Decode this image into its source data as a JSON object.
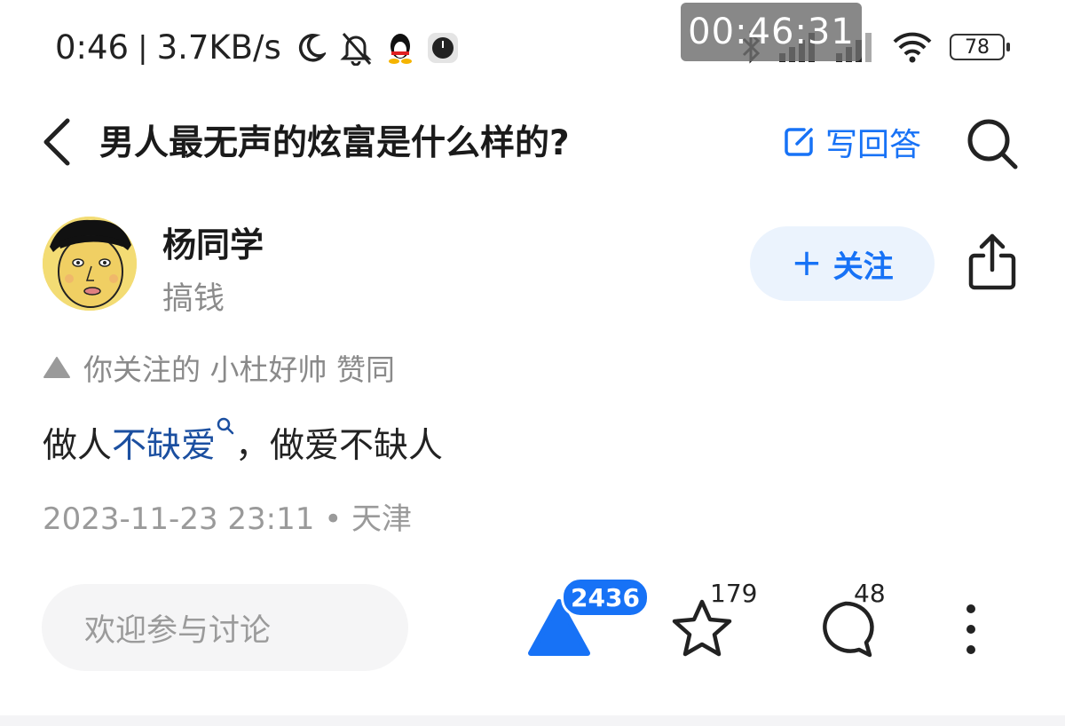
{
  "status_bar": {
    "time": "0:46",
    "net_speed": "3.7KB/s",
    "recording_timer": "00:46:31",
    "battery": "78",
    "separator": "|"
  },
  "header": {
    "back_icon": "chevron-left-icon",
    "question_title": "男人最无声的炫富是什么样的?",
    "write_answer_label": "写回答",
    "accent_color": "#1772f6"
  },
  "author": {
    "name": "杨同学",
    "bio": "搞钱",
    "follow_label": "关注",
    "follow_plus": "+"
  },
  "upvoted_hint": "你关注的 小杜好帅 赞同",
  "answer": {
    "text_before": "做人",
    "keyword": "不缺爱",
    "text_after": "，做爱不缺人",
    "timestamp": "2023-11-23 23:11 • 天津"
  },
  "bottom_bar": {
    "comment_placeholder": "欢迎参与讨论",
    "upvote_count": "2436",
    "favorite_count": "179",
    "comment_count": "48"
  }
}
